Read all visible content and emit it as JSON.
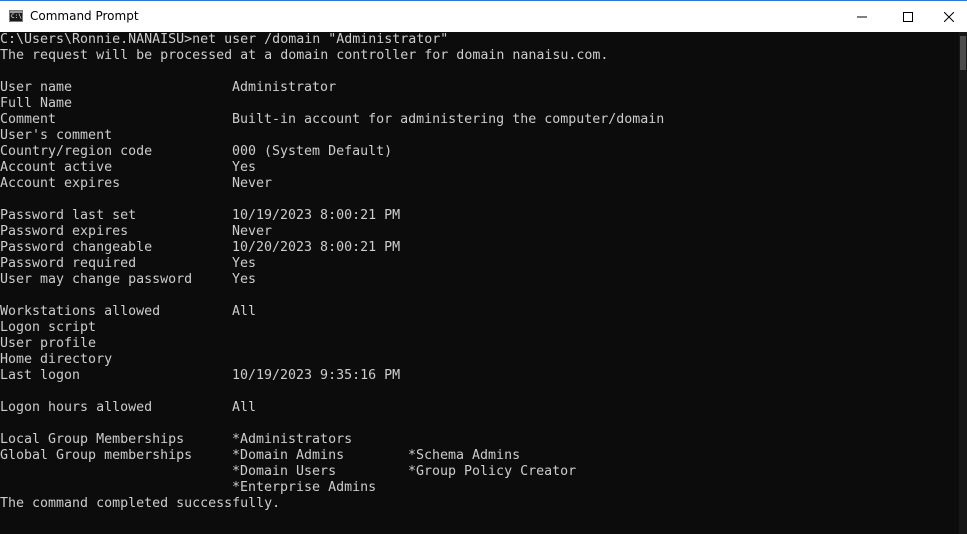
{
  "window": {
    "title": "Command Prompt",
    "icon": "cmd-icon",
    "icon_glyph": "C:\\"
  },
  "console": {
    "prompt_line": "C:\\Users\\Ronnie.NANAISU>net user /domain \"Administrator\"",
    "request_line": "The request will be processed at a domain controller for domain nanaisu.com.",
    "fields": {
      "user_name": {
        "label": "User name",
        "value": "Administrator"
      },
      "full_name": {
        "label": "Full Name",
        "value": ""
      },
      "comment": {
        "label": "Comment",
        "value": "Built-in account for administering the computer/domain"
      },
      "users_comment": {
        "label": "User's comment",
        "value": ""
      },
      "country_code": {
        "label": "Country/region code",
        "value": "000 (System Default)"
      },
      "account_active": {
        "label": "Account active",
        "value": "Yes"
      },
      "account_expires": {
        "label": "Account expires",
        "value": "Never"
      },
      "password_last_set": {
        "label": "Password last set",
        "value": "10/19/2023 8:00:21 PM"
      },
      "password_expires": {
        "label": "Password expires",
        "value": "Never"
      },
      "password_changeable": {
        "label": "Password changeable",
        "value": "10/20/2023 8:00:21 PM"
      },
      "password_required": {
        "label": "Password required",
        "value": "Yes"
      },
      "user_may_change_password": {
        "label": "User may change password",
        "value": "Yes"
      },
      "workstations_allowed": {
        "label": "Workstations allowed",
        "value": "All"
      },
      "logon_script": {
        "label": "Logon script",
        "value": ""
      },
      "user_profile": {
        "label": "User profile",
        "value": ""
      },
      "home_directory": {
        "label": "Home directory",
        "value": ""
      },
      "last_logon": {
        "label": "Last logon",
        "value": "10/19/2023 9:35:16 PM"
      },
      "logon_hours_allowed": {
        "label": "Logon hours allowed",
        "value": "All"
      }
    },
    "local_groups": {
      "label": "Local Group Memberships",
      "items": [
        "*Administrators"
      ]
    },
    "global_groups": {
      "label": "Global Group memberships",
      "items": [
        "*Domain Admins",
        "*Schema Admins",
        "*Domain Users",
        "*Group Policy Creator",
        "*Enterprise Admins"
      ]
    },
    "completion_line": "The command completed successfully."
  }
}
